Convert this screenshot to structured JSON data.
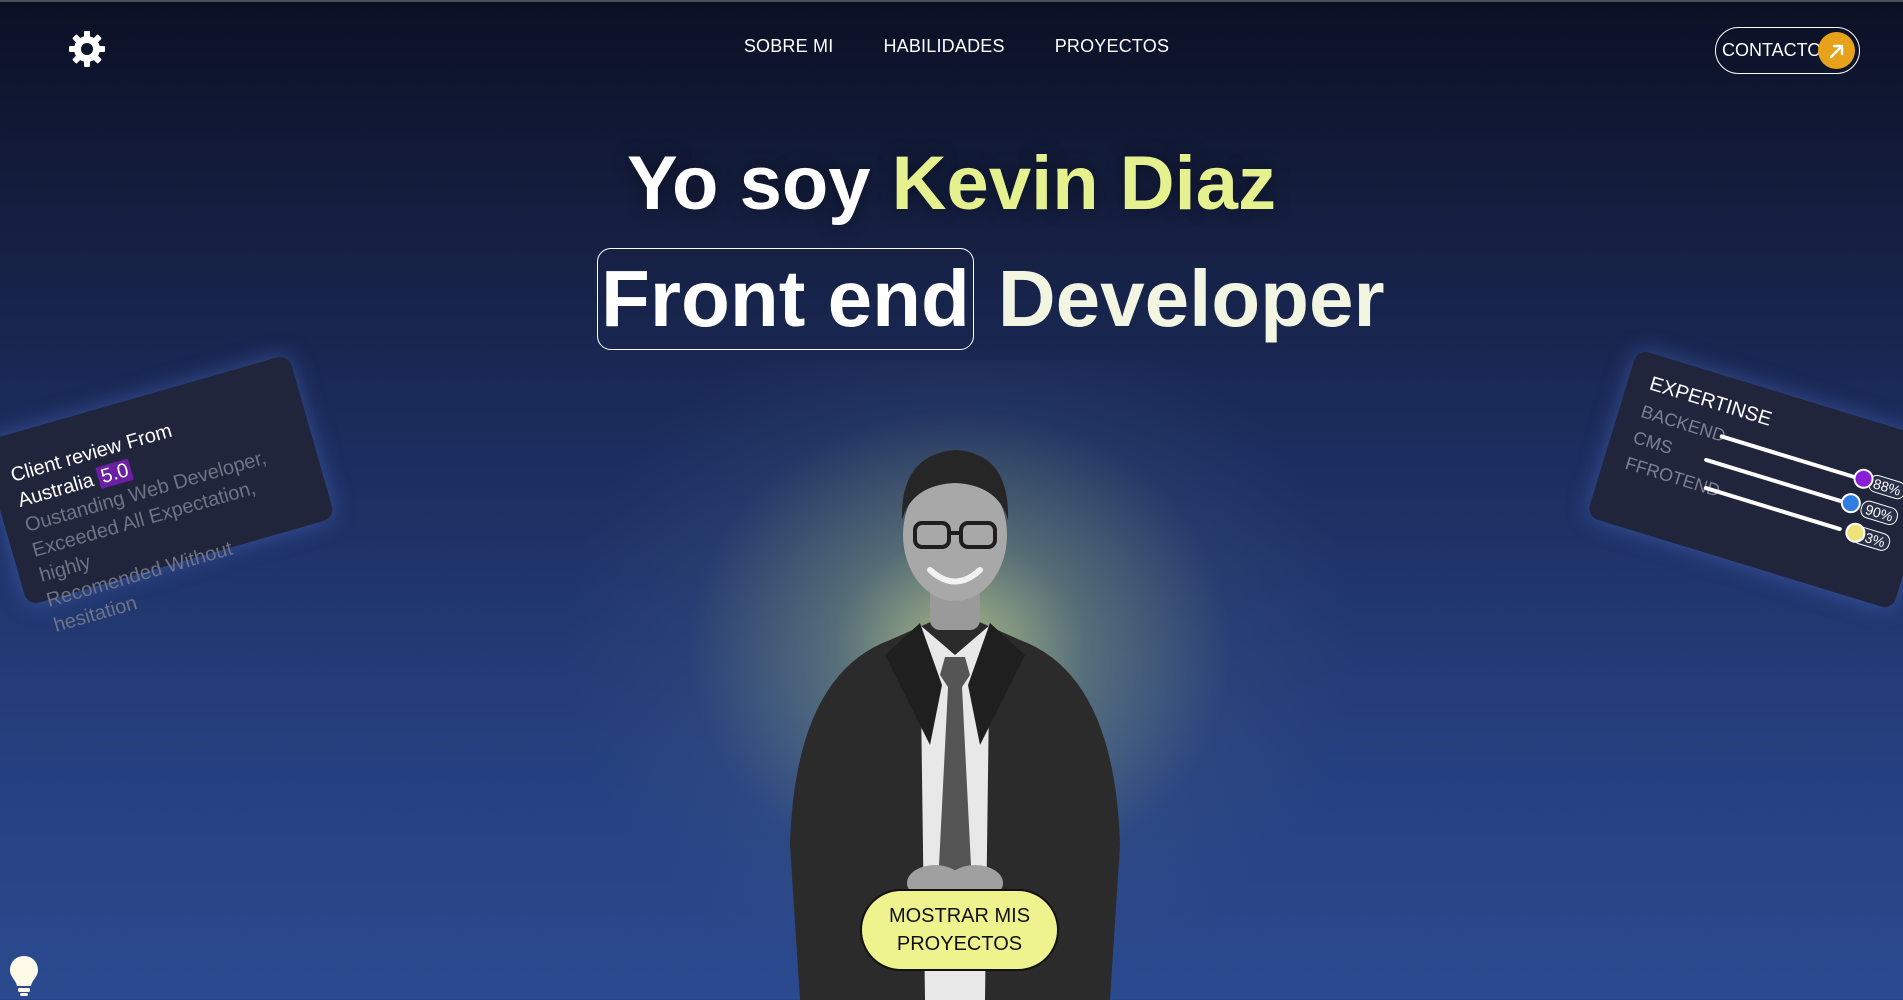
{
  "nav": {
    "items": [
      "SOBRE MI",
      "HABILIDADES",
      "PROYECTOS"
    ],
    "contact_label": "CONTACTO"
  },
  "hero": {
    "line1_prefix": "Yo soy",
    "line1_name": "Kevin Diaz",
    "line2_boxed": "Front end",
    "line2_rest": "Developer"
  },
  "review": {
    "title_line1": "Client review From",
    "title_line2": "Australia",
    "rating": "5.0",
    "body_lines": [
      "Oustanding Web Developer,",
      "Exceeded All Expectation, highly",
      "Recomended Without hesitation"
    ]
  },
  "expertise": {
    "title": "EXPERTINSE",
    "skills": [
      {
        "label": "BACKEND",
        "value": 88,
        "display": "88%",
        "color": "#8a1ed6"
      },
      {
        "label": "CMS",
        "value": 90,
        "display": "90%",
        "color": "#2f7de0"
      },
      {
        "label": "FFROTEND",
        "value": 93,
        "display": "93%",
        "color": "#f0e27a"
      }
    ]
  },
  "cta": {
    "line1": "MOSTRAR MIS",
    "line2": "PROYECTOS"
  },
  "colors": {
    "accent_yellow": "#e5f08f",
    "contact_orange": "#e6a21a"
  },
  "icons": {
    "logo": "gear-logo-icon",
    "contact_arrow": "arrow-up-right-icon",
    "theme_toggle": "lightbulb-icon"
  }
}
